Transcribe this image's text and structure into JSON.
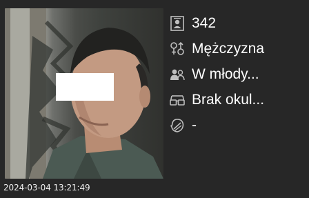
{
  "capture": {
    "timestamp": "2024-03-04 13:21:49"
  },
  "attributes": [
    {
      "icon": "id-badge-icon",
      "value": "342"
    },
    {
      "icon": "gender-icon",
      "value": "Mężczyzna"
    },
    {
      "icon": "age-group-icon",
      "value": "W młody..."
    },
    {
      "icon": "glasses-icon",
      "value": "Brak okul..."
    },
    {
      "icon": "mask-icon",
      "value": "-"
    }
  ],
  "colors": {
    "background": "#272727",
    "text": "#ffffff",
    "icon": "#bfbfbf",
    "privacy_box": "#ffffff"
  }
}
